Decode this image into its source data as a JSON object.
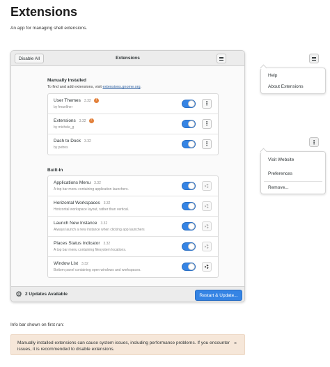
{
  "page": {
    "title": "Extensions",
    "subtitle": "An app for managing shell extensions."
  },
  "window": {
    "disable_all_label": "Disable All",
    "title": "Extensions",
    "manual": {
      "heading": "Manually Installed",
      "hint_prefix": "To find and add extensions, visit ",
      "hint_link": "extensions.gnome.org",
      "hint_suffix": ".",
      "items": [
        {
          "name": "User Themes",
          "version": "3.32",
          "author": "by fmuellner",
          "warning": "!"
        },
        {
          "name": "Extensions",
          "version": "3.32",
          "author": "by michele_g",
          "warning": "!"
        },
        {
          "name": "Dash to Dock",
          "version": "3.32",
          "author": "by petres"
        }
      ]
    },
    "builtin": {
      "heading": "Built-In",
      "items": [
        {
          "name": "Applications Menu",
          "version": "3.32",
          "description": "A top bar menu containing application launchers."
        },
        {
          "name": "Horizontal Workspaces",
          "version": "3.32",
          "description": "Horizontal workspace layout, rather than vertical."
        },
        {
          "name": "Launch New Instance",
          "version": "3.32",
          "description": "Always launch a new instance when clicking app launchers"
        },
        {
          "name": "Places Status Indicator",
          "version": "3.32",
          "description": "A top bar menu containing filesystem locations."
        },
        {
          "name": "Window List",
          "version": "3.32",
          "description": "Bottom panel containing open windows and workspaces."
        }
      ]
    },
    "bottombar": {
      "updates_label": "2 Updates Available",
      "restart_label": "Restart & Update..."
    }
  },
  "app_menu": {
    "items": [
      "Help",
      "About Extensions"
    ]
  },
  "row_menu": {
    "items": [
      "Visit Website",
      "Preferences",
      "Remove..."
    ]
  },
  "infobar": {
    "caption": "Info bar shown on first run:",
    "message": "Manually installed extensions can cause system issues, including performance problems. If you encounter issues, it is recommended to disable extensions.",
    "close": "×"
  },
  "colors": {
    "accent": "#3584e4",
    "warning": "#e2803a",
    "infobar_bg": "#f6e7d9"
  }
}
